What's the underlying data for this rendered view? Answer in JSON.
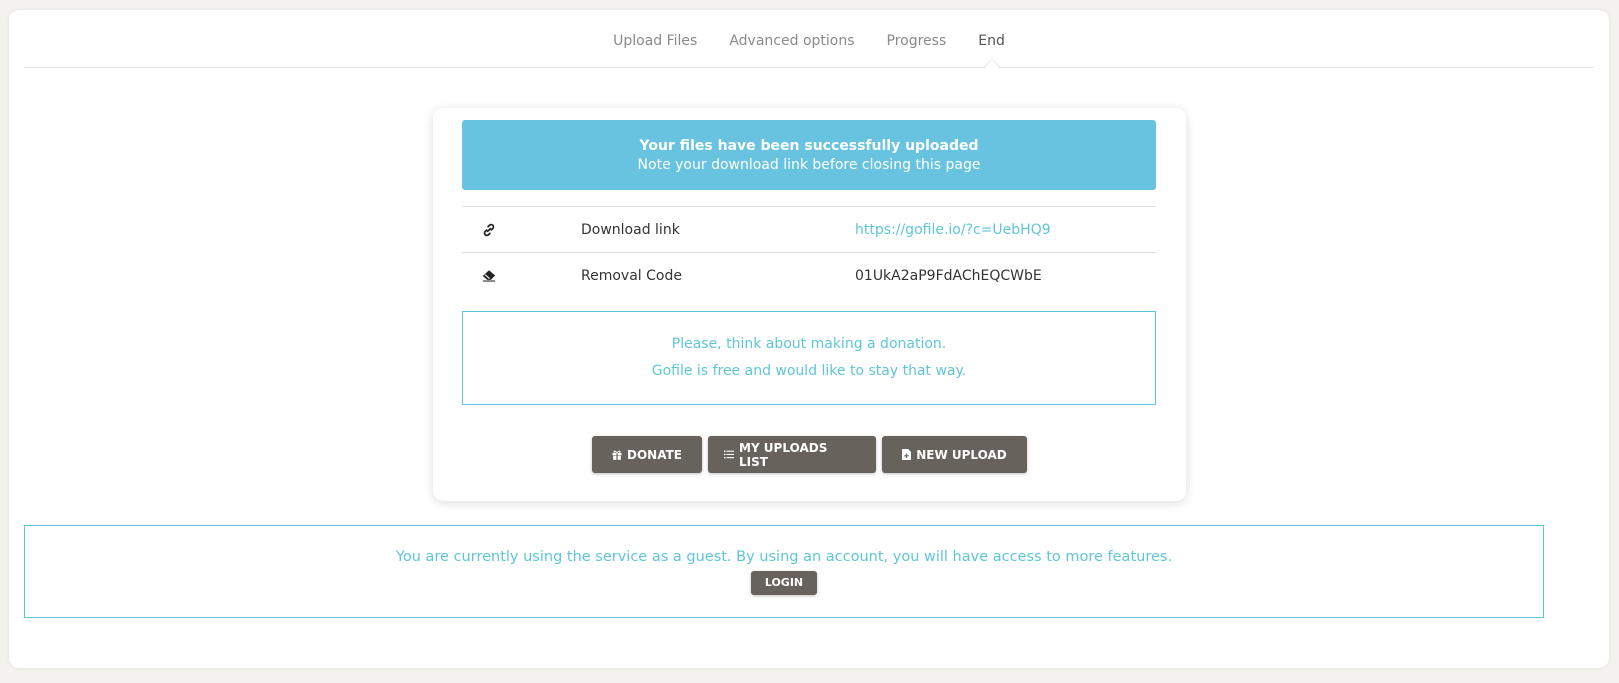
{
  "tabs": [
    {
      "label": "Upload Files"
    },
    {
      "label": "Advanced options"
    },
    {
      "label": "Progress"
    },
    {
      "label": "End"
    }
  ],
  "success": {
    "title": "Your files have been successfully uploaded",
    "subtitle": "Note your download link before closing this page"
  },
  "info": {
    "download": {
      "icon": "link-icon",
      "label": "Download link",
      "value": "https://gofile.io/?c=UebHQ9"
    },
    "removal": {
      "icon": "eraser-icon",
      "label": "Removal Code",
      "value": "01UkA2aP9FdAChEQCWbE"
    }
  },
  "donation": {
    "line1": "Please, think about making a donation.",
    "line2": "Gofile is free and would like to stay that way."
  },
  "buttons": {
    "donate": "DONATE",
    "uploads": "MY UPLOADS LIST",
    "new_upload": "NEW UPLOAD"
  },
  "guest": {
    "message": "You are currently using the service as a guest. By using an account, you will have access to more features.",
    "login": "LOGIN"
  },
  "colors": {
    "accent": "#5ec6d6",
    "alert_bg": "#67c3df",
    "button_bg": "#67625b"
  }
}
